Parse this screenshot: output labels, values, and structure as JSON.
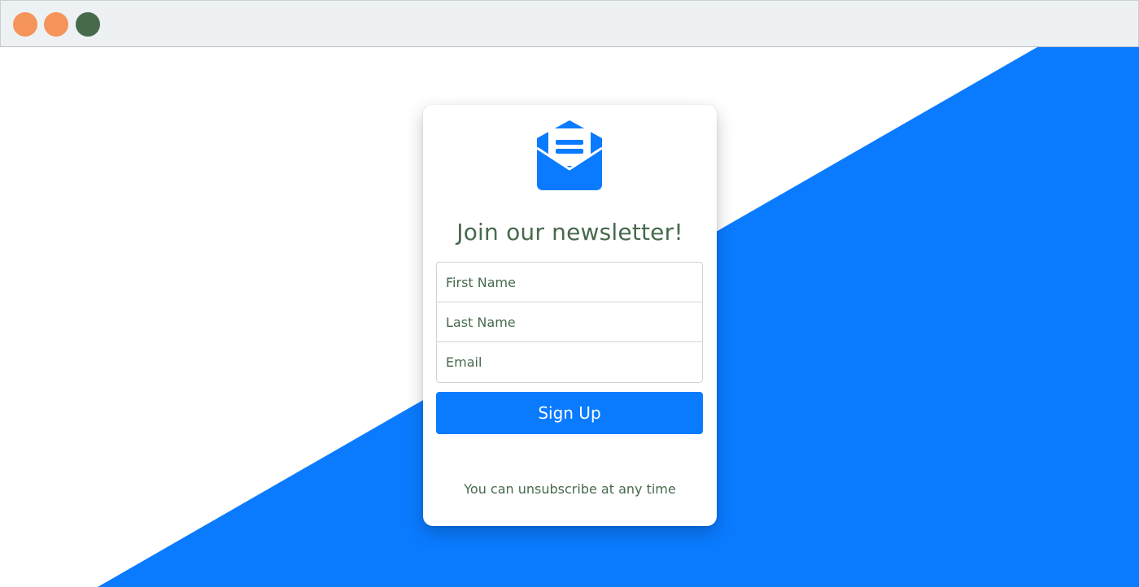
{
  "window": {
    "dots": [
      {
        "color": "#f4945b"
      },
      {
        "color": "#f4945b"
      },
      {
        "color": "#476a4c"
      }
    ]
  },
  "colors": {
    "accent": "#0a7bff",
    "text_green": "#476a4c"
  },
  "newsletter": {
    "icon": "envelope-open-icon",
    "title": "Join our newsletter!",
    "first_name_placeholder": "First Name",
    "last_name_placeholder": "Last Name",
    "email_placeholder": "Email",
    "submit_label": "Sign Up",
    "note": "You can unsubscribe at any time"
  }
}
